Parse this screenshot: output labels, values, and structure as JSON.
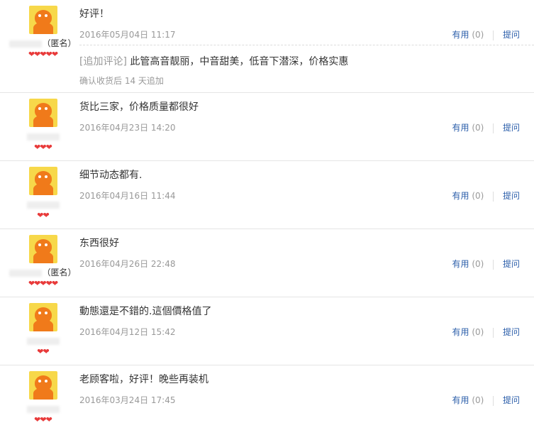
{
  "reviews": [
    {
      "username": "（匿名）",
      "stars": "❤❤❤❤❤",
      "content": "好评！",
      "date": "2016年05月04日  11:17",
      "useful_label": "有用",
      "useful_count": "(0)",
      "ask_label": "提问",
      "append_tag": "[追加评论]",
      "append_text": "此管高音靓丽，中音甜美，低音下潜深，价格实惠",
      "append_time": "确认收货后 14 天追加"
    },
    {
      "username": "",
      "stars": "❤❤❤",
      "content": "货比三家，价格质量都很好",
      "date": "2016年04月23日  14:20",
      "useful_label": "有用",
      "useful_count": "(0)",
      "ask_label": "提问"
    },
    {
      "username": "",
      "stars": "❤❤",
      "content": "细节动态都有.",
      "date": "2016年04月16日  11:44",
      "useful_label": "有用",
      "useful_count": "(0)",
      "ask_label": "提问"
    },
    {
      "username": "（匿名）",
      "stars": "❤❤❤❤❤",
      "content": "东西很好",
      "date": "2016年04月26日  22:48",
      "useful_label": "有用",
      "useful_count": "(0)",
      "ask_label": "提问"
    },
    {
      "username": "",
      "stars": "❤❤",
      "content": "動態還是不錯的.這個價格值了",
      "date": "2016年04月12日  15:42",
      "useful_label": "有用",
      "useful_count": "(0)",
      "ask_label": "提问"
    },
    {
      "username": "",
      "stars": "❤❤❤",
      "content": "老顾客啦，好评！晚些再装机",
      "date": "2016年03月24日  17:45",
      "useful_label": "有用",
      "useful_count": "(0)",
      "ask_label": "提问"
    }
  ]
}
